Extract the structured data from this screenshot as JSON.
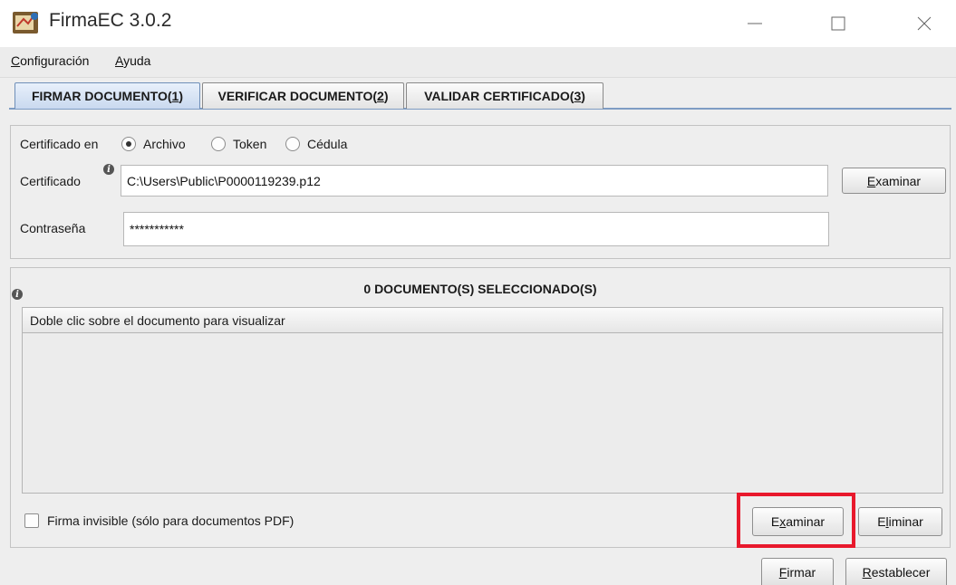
{
  "window": {
    "title": "FirmaEC 3.0.2"
  },
  "menu": {
    "configuracion_rest": "onfiguración",
    "configuracion_mnemonic": "C",
    "ayuda_mnemonic": "A",
    "ayuda_rest": "yuda"
  },
  "tabs": [
    {
      "label": "FIRMAR DOCUMENTO ",
      "mnemonic": "1",
      "active": true
    },
    {
      "label": "VERIFICAR DOCUMENTO ",
      "mnemonic": "2",
      "active": false
    },
    {
      "label": "VALIDAR CERTIFICADO ",
      "mnemonic": "3",
      "active": false
    }
  ],
  "certificate_panel": {
    "certificado_en_label": "Certificado en",
    "radio_options": [
      {
        "label": "Archivo",
        "checked": true
      },
      {
        "label": "Token",
        "checked": false
      },
      {
        "label": "Cédula",
        "checked": false
      }
    ],
    "certificado_label": "Certificado",
    "certificado_value": "C:\\Users\\Public\\P0000119239.p12",
    "examinar_mnemonic": "E",
    "examinar_rest": "xaminar",
    "contrasena_label": "Contraseña",
    "contrasena_value": "***********"
  },
  "documents_panel": {
    "count_title": "0 DOCUMENTO(S) SELECCIONADO(S)",
    "table_header": "Doble clic sobre el documento para visualizar",
    "invisible_signature_label": "Firma invisible (sólo para documentos PDF)",
    "invisible_signature_checked": false,
    "examinar_pre": "E",
    "examinar_mnemonic": "x",
    "examinar_rest": "aminar",
    "eliminar_pre": "E",
    "eliminar_mnemonic": "l",
    "eliminar_rest": "iminar"
  },
  "footer": {
    "firmar_mnemonic": "F",
    "firmar_rest": "irmar",
    "restablecer_mnemonic": "R",
    "restablecer_rest": "establecer"
  },
  "colors": {
    "highlight": "#e8192c",
    "active_tab": "#c9d9ef"
  }
}
